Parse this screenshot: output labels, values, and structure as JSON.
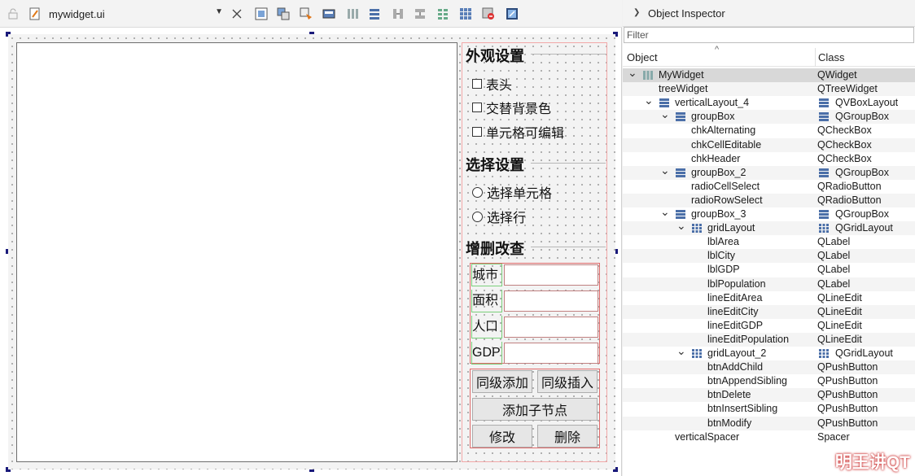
{
  "designer": {
    "file_name": "mywidget.ui",
    "groups": {
      "appearance_title": "外观设置",
      "selection_title": "选择设置",
      "crud_title": "增删改查"
    },
    "checkboxes": [
      "表头",
      "交替背景色",
      "单元格可编辑"
    ],
    "radios": [
      "选择单元格",
      "选择行"
    ],
    "labels": [
      "城市",
      "面积",
      "人口",
      "GDP"
    ],
    "buttons": {
      "add_sibling": "同级添加",
      "insert_sibling": "同级插入",
      "add_child": "添加子节点",
      "modify": "修改",
      "delete": "删除"
    }
  },
  "inspector": {
    "title": "Object Inspector",
    "filter_placeholder": "Filter",
    "col_object": "Object",
    "col_class": "Class",
    "rows": [
      {
        "name": "MyWidget",
        "cls": "QWidget"
      },
      {
        "name": "treeWidget",
        "cls": "QTreeWidget"
      },
      {
        "name": "verticalLayout_4",
        "cls": "QVBoxLayout"
      },
      {
        "name": "groupBox",
        "cls": "QGroupBox"
      },
      {
        "name": "chkAlternating",
        "cls": "QCheckBox"
      },
      {
        "name": "chkCellEditable",
        "cls": "QCheckBox"
      },
      {
        "name": "chkHeader",
        "cls": "QCheckBox"
      },
      {
        "name": "groupBox_2",
        "cls": "QGroupBox"
      },
      {
        "name": "radioCellSelect",
        "cls": "QRadioButton"
      },
      {
        "name": "radioRowSelect",
        "cls": "QRadioButton"
      },
      {
        "name": "groupBox_3",
        "cls": "QGroupBox"
      },
      {
        "name": "gridLayout",
        "cls": "QGridLayout"
      },
      {
        "name": "lblArea",
        "cls": "QLabel"
      },
      {
        "name": "lblCity",
        "cls": "QLabel"
      },
      {
        "name": "lblGDP",
        "cls": "QLabel"
      },
      {
        "name": "lblPopulation",
        "cls": "QLabel"
      },
      {
        "name": "lineEditArea",
        "cls": "QLineEdit"
      },
      {
        "name": "lineEditCity",
        "cls": "QLineEdit"
      },
      {
        "name": "lineEditGDP",
        "cls": "QLineEdit"
      },
      {
        "name": "lineEditPopulation",
        "cls": "QLineEdit"
      },
      {
        "name": "gridLayout_2",
        "cls": "QGridLayout"
      },
      {
        "name": "btnAddChild",
        "cls": "QPushButton"
      },
      {
        "name": "btnAppendSibling",
        "cls": "QPushButton"
      },
      {
        "name": "btnDelete",
        "cls": "QPushButton"
      },
      {
        "name": "btnInsertSibling",
        "cls": "QPushButton"
      },
      {
        "name": "btnModify",
        "cls": "QPushButton"
      },
      {
        "name": "verticalSpacer",
        "cls": "Spacer"
      }
    ]
  },
  "watermark": "明王讲QT",
  "colors": {
    "selection_row": "#d8d8d8",
    "layout_red": "#e06a6a",
    "grid_green": "#7bd07b",
    "handle": "#1a1a7a"
  }
}
